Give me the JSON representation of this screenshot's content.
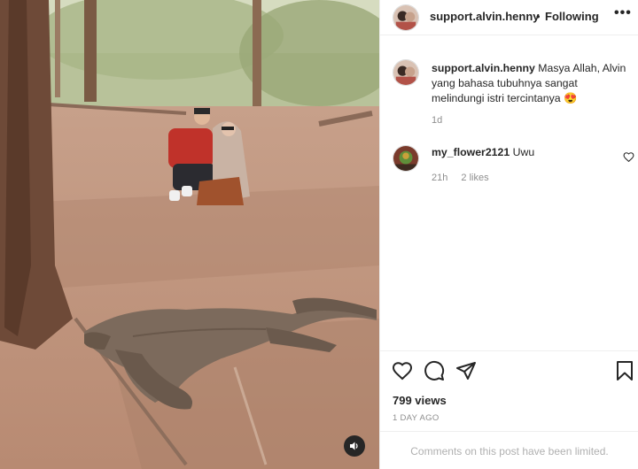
{
  "post": {
    "username": "support.alvin.henny",
    "separator": "•",
    "follow_label": "Following",
    "more_icon": "more-options-icon",
    "caption": {
      "username": "support.alvin.henny",
      "text": "Masya Allah, Alvin yang bahasa tubuhnya sangat melindungi istri tercintanya 😍",
      "time": "1d"
    },
    "comments": [
      {
        "username": "my_flower2121",
        "text": "Uwu",
        "time": "21h",
        "likes": "2 likes"
      }
    ],
    "views": "799 views",
    "time_ago": "1 DAY AGO",
    "comments_limited": "Comments on this post have been limited."
  },
  "media": {
    "sound_icon": "sound-icon"
  },
  "colors": {
    "text": "#262626",
    "secondary": "#8e8e8e",
    "border": "#efefef"
  }
}
